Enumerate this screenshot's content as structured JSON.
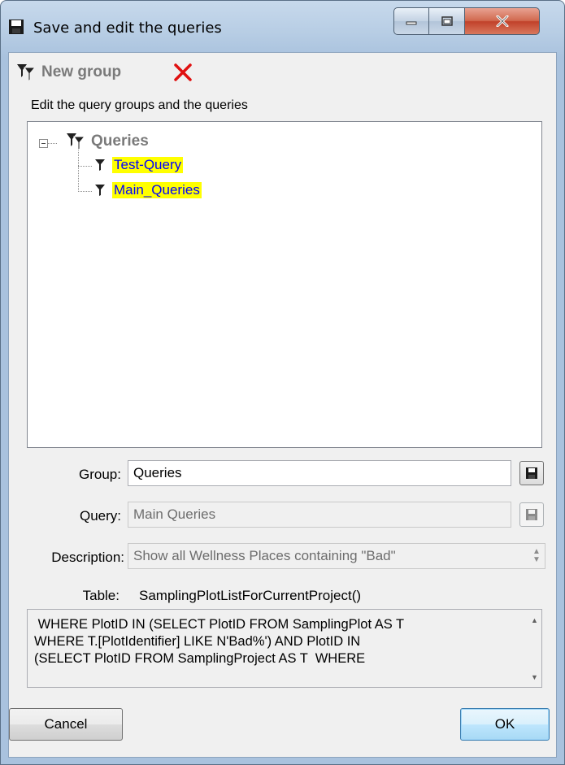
{
  "window": {
    "title": "Save and edit the queries"
  },
  "toolbar": {
    "new_group_label": "New group"
  },
  "hint": "Edit the query groups and the queries",
  "tree": {
    "root": "Queries",
    "children": [
      "Test-Query",
      "Main_Queries"
    ]
  },
  "form": {
    "group_label": "Group:",
    "group_value": "Queries",
    "query_label": "Query:",
    "query_value": "Main Queries",
    "description_label": "Description:",
    "description_value": "Show all Wellness Places containing \"Bad\"",
    "table_label": "Table:",
    "table_value": "SamplingPlotListForCurrentProject()"
  },
  "sql": " WHERE PlotID IN (SELECT PlotID FROM SamplingPlot AS T\nWHERE T.[PlotIdentifier] LIKE N'Bad%') AND PlotID IN\n(SELECT PlotID FROM SamplingProject AS T  WHERE",
  "buttons": {
    "cancel": "Cancel",
    "ok": "OK"
  }
}
